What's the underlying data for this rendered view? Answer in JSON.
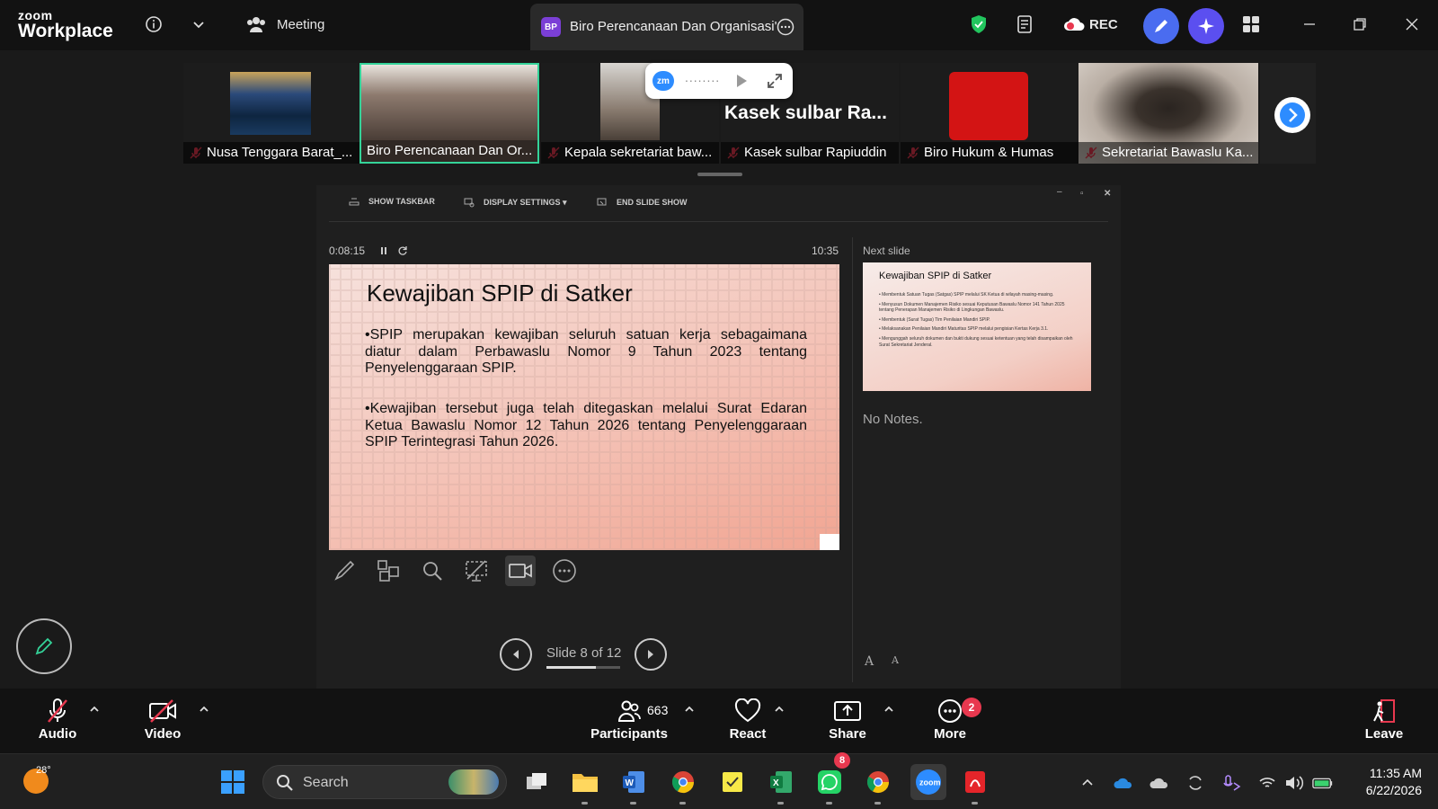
{
  "titlebar": {
    "logo_top": "zoom",
    "logo_bottom": "Workplace",
    "meeting_label": "Meeting",
    "active_tab_initials": "BP",
    "active_tab_title": "Biro Perencanaan Dan Organisasi'",
    "rec_label": "REC"
  },
  "filmstrip": {
    "participants": [
      {
        "name": "Nusa Tenggara Barat_...",
        "muted": true
      },
      {
        "name": "Biro Perencanaan Dan Or...",
        "muted": false,
        "active": true
      },
      {
        "name": "Kepala sekretariat baw...",
        "muted": true
      },
      {
        "name": "Kasek sulbar Rapiuddin",
        "muted": true
      },
      {
        "name": "Biro Hukum & Humas",
        "muted": true
      },
      {
        "name": "Sekretariat Bawaslu Ka...",
        "muted": true
      }
    ],
    "popup_title": "Kasek sulbar Ra...",
    "popup_dots": "........"
  },
  "presenter": {
    "tools": {
      "show_taskbar": "SHOW TASKBAR",
      "display_settings": "DISPLAY SETTINGS ▾",
      "end_show": "END SLIDE SHOW"
    },
    "elapsed": "0:08:15",
    "clock": "10:35",
    "next_label": "Next slide",
    "notes": "No Notes.",
    "slide_counter": "Slide 8 of 12",
    "slide_progress": 0.67,
    "slide": {
      "title": "Kewajiban SPIP di Satker",
      "bullet1": "•SPIP merupakan kewajiban seluruh satuan kerja sebagaimana diatur dalam Perbawaslu Nomor 9 Tahun 2023 tentang Penyelenggaraan SPIP.",
      "bullet2": "•Kewajiban tersebut juga telah ditegaskan melalui Surat Edaran Ketua Bawaslu Nomor 12 Tahun 2026 tentang Penyelenggaraan SPIP Terintegrasi Tahun 2026."
    },
    "next_slide": {
      "title": "Kewajiban SPIP di Satker",
      "items": [
        "• Membentuk Satuan Tugas (Satgas) SPIP melalui SK Ketua di wilayah masing-masing.",
        "• Menyusun Dokumen Manajemen Risiko sesuai Keputusan Bawaslu Nomor 141 Tahun 2025 tentang Penerapan Manajemen Risiko di Lingkungan Bawaslu.",
        "• Membentuk (Surat Tugas) Tim Penilaian Mandiri SPIP.",
        "• Melaksanakan Penilaian Mandiri Maturitas SPIP melalui pengisian Kertas Kerja 3.1.",
        "• Mengunggah seluruh dokumen dan bukti dukung sesuai ketentuan yang telah disampaikan oleh Surat Sekretariat Jenderal."
      ]
    },
    "font_up": "A",
    "font_down": "A"
  },
  "toolbar": {
    "audio": "Audio",
    "video": "Video",
    "participants": "Participants",
    "participant_count": "663",
    "react": "React",
    "share": "Share",
    "more": "More",
    "more_badge": "2",
    "leave": "Leave"
  },
  "taskbar": {
    "temperature": "28°",
    "search_placeholder": "Search",
    "whatsapp_badge": "8",
    "time": "11:35 AM",
    "date": "6/22/2026"
  },
  "colors": {
    "accent_blue": "#2d8cff",
    "active_green": "#34d399",
    "danger_red": "#e8384f"
  }
}
